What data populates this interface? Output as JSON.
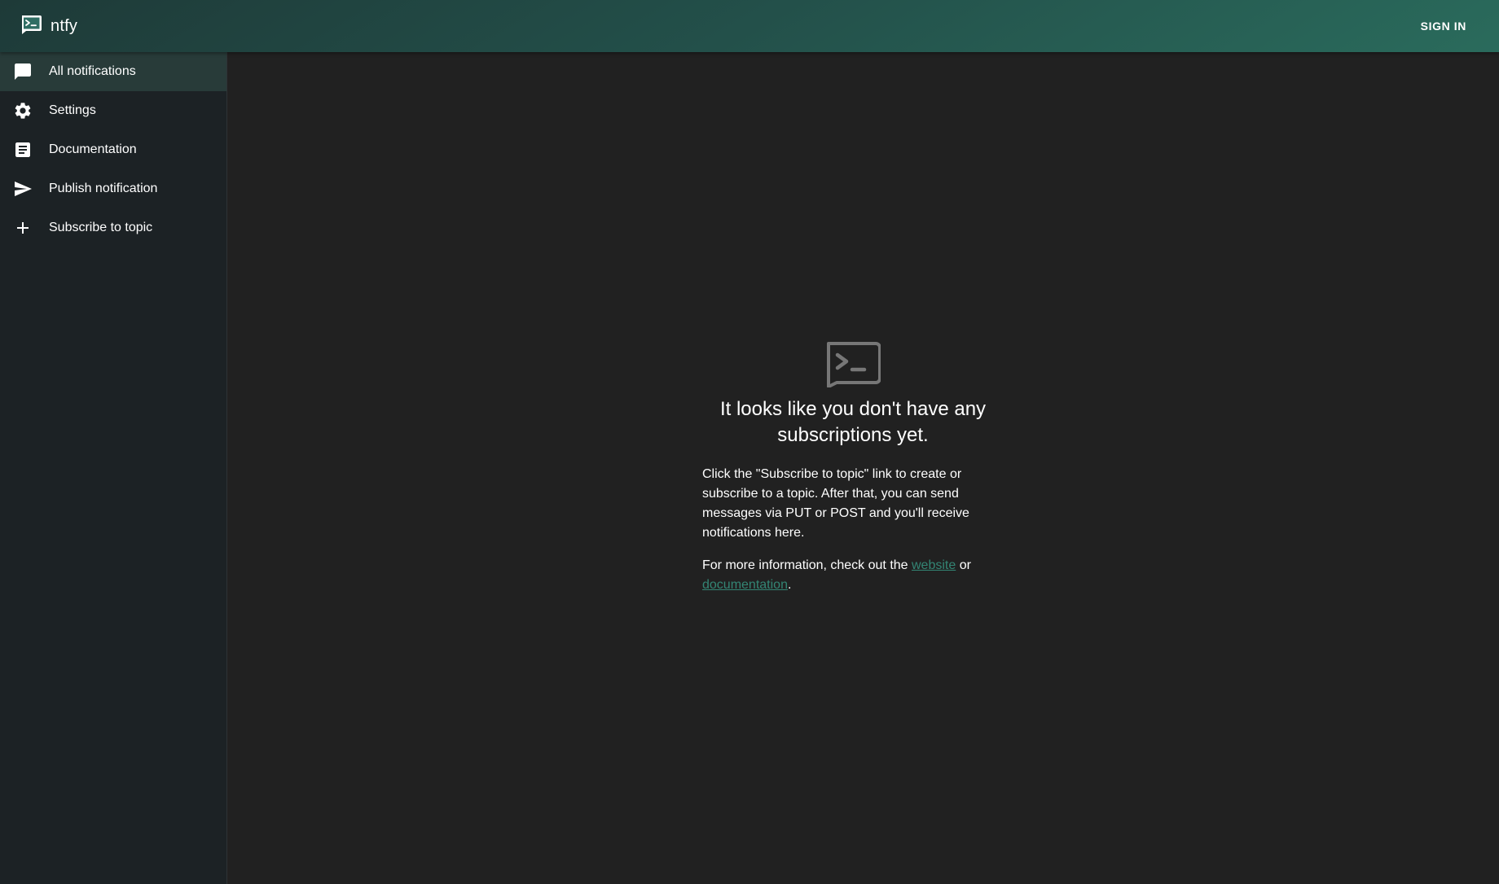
{
  "app": {
    "title": "ntfy",
    "logo_icon": "ntfy-terminal-logo-icon",
    "sign_in_label": "SIGN IN"
  },
  "sidebar": {
    "items": [
      {
        "label": "All notifications",
        "icon": "chat-bubble-icon",
        "active": true
      },
      {
        "label": "Settings",
        "icon": "gear-icon",
        "active": false
      },
      {
        "label": "Documentation",
        "icon": "document-icon",
        "active": false
      },
      {
        "label": "Publish notification",
        "icon": "send-icon",
        "active": false
      },
      {
        "label": "Subscribe to topic",
        "icon": "plus-icon",
        "active": false
      }
    ]
  },
  "empty_state": {
    "icon": "ntfy-terminal-logo-icon",
    "heading": "It looks like you don't have any subscriptions yet.",
    "description": "Click the \"Subscribe to topic\" link to create or subscribe to a topic. After that, you can send messages via PUT or POST and you'll receive notifications here.",
    "info_prefix": "For more information, check out the ",
    "website_link": "website",
    "info_middle": " or ",
    "documentation_link": "documentation",
    "info_suffix": "."
  },
  "colors": {
    "accent": "#338574",
    "appbar_start": "#1e3a38",
    "appbar_end": "#2a6b5c",
    "sidebar_bg": "#1c2225",
    "sidebar_active": "#283b39",
    "main_bg": "#212121"
  }
}
